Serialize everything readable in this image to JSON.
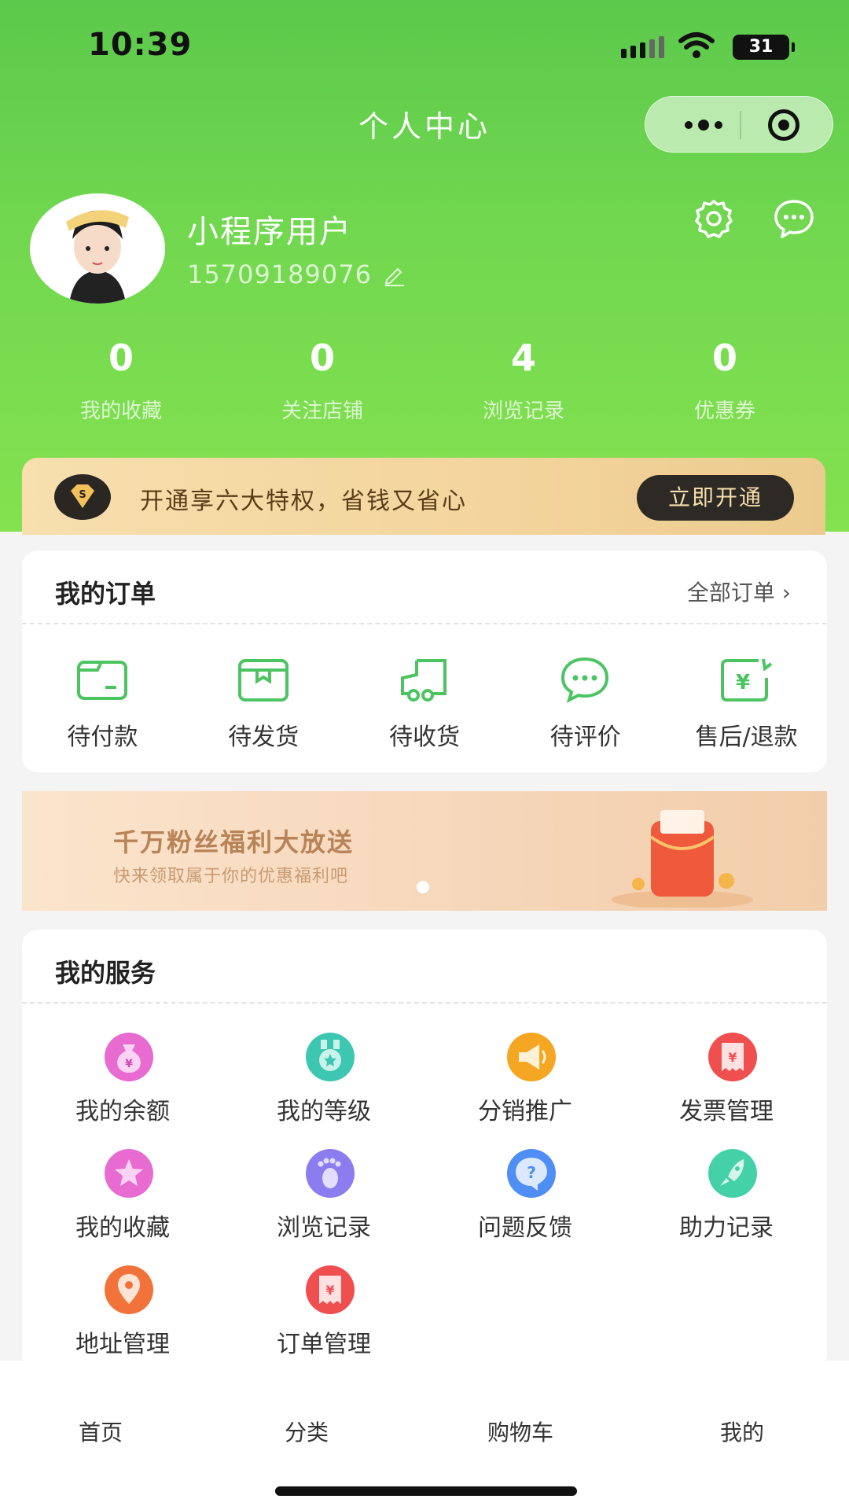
{
  "status_bar": {
    "time": "10:39",
    "battery": "31"
  },
  "nav": {
    "title": "个人中心"
  },
  "profile": {
    "username": "小程序用户",
    "phone": "15709189076"
  },
  "stats": [
    {
      "value": "0",
      "label": "我的收藏"
    },
    {
      "value": "0",
      "label": "关注店铺"
    },
    {
      "value": "4",
      "label": "浏览记录"
    },
    {
      "value": "0",
      "label": "优惠券"
    }
  ],
  "vip": {
    "text": "开通享六大特权，省钱又省心",
    "button": "立即开通"
  },
  "orders": {
    "title": "我的订单",
    "all_link": "全部订单",
    "items": [
      {
        "label": "待付款",
        "icon": "wallet-icon"
      },
      {
        "label": "待发货",
        "icon": "box-icon"
      },
      {
        "label": "待收货",
        "icon": "truck-icon"
      },
      {
        "label": "待评价",
        "icon": "comment-icon"
      },
      {
        "label": "售后/退款",
        "icon": "refund-icon"
      }
    ]
  },
  "banner": {
    "title": "千万粉丝福利大放送",
    "subtitle": "快来领取属于你的优惠福利吧"
  },
  "services": {
    "title": "我的服务",
    "items": [
      {
        "label": "我的余额",
        "icon": "money-bag-icon",
        "color": "#e86bd2"
      },
      {
        "label": "我的等级",
        "icon": "level-medal-icon",
        "color": "#3ec7b0"
      },
      {
        "label": "分销推广",
        "icon": "megaphone-icon",
        "color": "#f5a623"
      },
      {
        "label": "发票管理",
        "icon": "invoice-icon",
        "color": "#ef4f4f"
      },
      {
        "label": "我的收藏",
        "icon": "star-icon",
        "color": "#e86bd2"
      },
      {
        "label": "浏览记录",
        "icon": "footprint-icon",
        "color": "#8b7cf0"
      },
      {
        "label": "问题反馈",
        "icon": "question-icon",
        "color": "#4f8ef5"
      },
      {
        "label": "助力记录",
        "icon": "rocket-icon",
        "color": "#45d1a8"
      },
      {
        "label": "地址管理",
        "icon": "location-pin-icon",
        "color": "#f2733a"
      },
      {
        "label": "订单管理",
        "icon": "order-ticket-icon",
        "color": "#ef4f4f"
      }
    ]
  },
  "tabbar": {
    "home": "首页",
    "category": "分类",
    "cart": "购物车",
    "mine": "我的"
  },
  "colors": {
    "brand_green": "#6fd54e",
    "order_icon": "#4cc462",
    "vip_gold": "#f3d49c"
  }
}
